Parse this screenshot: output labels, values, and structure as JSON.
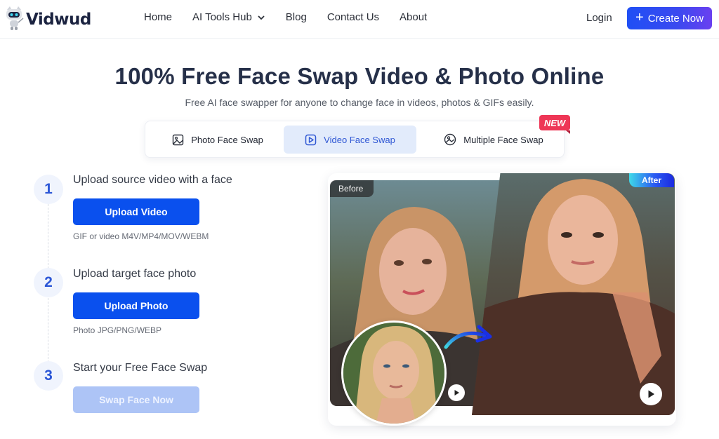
{
  "header": {
    "brand": "Vidwud",
    "nav": [
      {
        "label": "Home"
      },
      {
        "label": "AI Tools Hub",
        "has_dropdown": true
      },
      {
        "label": "Blog"
      },
      {
        "label": "Contact Us"
      },
      {
        "label": "About"
      }
    ],
    "login_label": "Login",
    "create_label": "Create Now",
    "create_icon": "plus-icon"
  },
  "hero": {
    "title": "100% Free Face Swap Video & Photo Online",
    "subtitle": "Free AI face swapper for anyone to change face in videos, photos & GIFs easily."
  },
  "tabs": {
    "items": [
      {
        "label": "Photo Face Swap",
        "icon": "image-icon",
        "active": false
      },
      {
        "label": "Video Face Swap",
        "icon": "video-play-icon",
        "active": true
      },
      {
        "label": "Multiple Face Swap",
        "icon": "multi-face-icon",
        "active": false
      }
    ],
    "new_badge": "NEW"
  },
  "steps": [
    {
      "number": "1",
      "title": "Upload source video with a face",
      "button": "Upload Video",
      "hint": "GIF or video M4V/MP4/MOV/WEBM",
      "enabled": true
    },
    {
      "number": "2",
      "title": "Upload target face photo",
      "button": "Upload Photo",
      "hint": "Photo JPG/PNG/WEBP",
      "enabled": true
    },
    {
      "number": "3",
      "title": "Start your Free Face Swap",
      "button": "Swap Face Now",
      "hint": "",
      "enabled": false
    }
  ],
  "preview": {
    "before_label": "Before",
    "after_label": "After"
  },
  "colors": {
    "primary": "#0a50ee",
    "primary_disabled": "#adc4f6",
    "active_tab_bg": "#e2ebfb",
    "active_tab_text": "#2f57d4",
    "new_badge": "#ee3656",
    "title": "#263049"
  }
}
